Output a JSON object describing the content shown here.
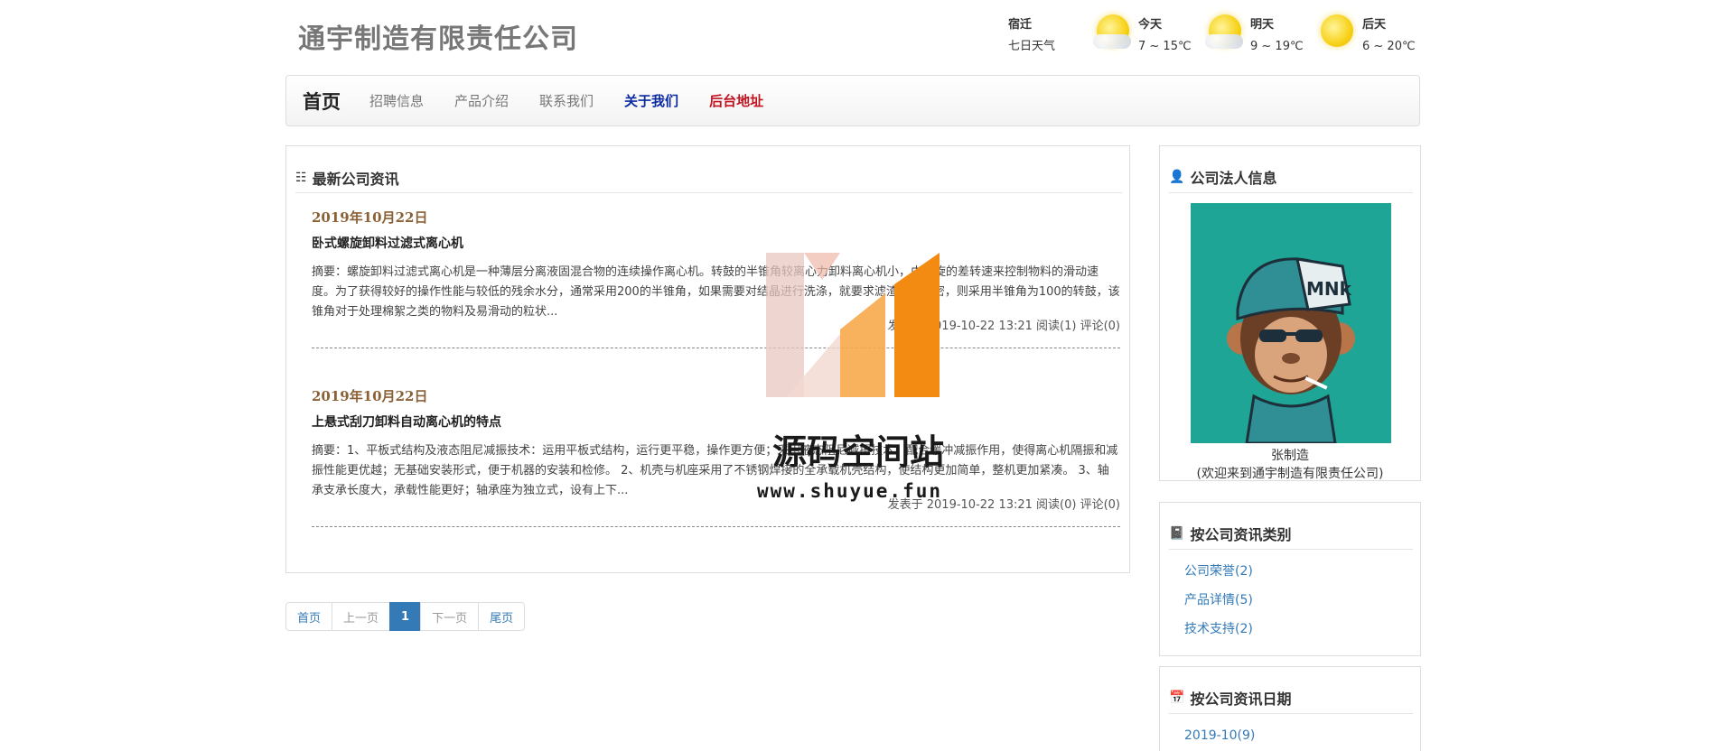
{
  "header": {
    "logo": "通宇制造有限责任公司"
  },
  "weather": {
    "city": "宿迁",
    "subtitle": "七日天气",
    "days": [
      {
        "label": "今天",
        "temp": "7 ~ 15℃",
        "icon": "sun-cloud-icon"
      },
      {
        "label": "明天",
        "temp": "9 ~ 19℃",
        "icon": "sun-cloud-icon"
      },
      {
        "label": "后天",
        "temp": "6 ~ 20℃",
        "icon": "sun-icon"
      }
    ]
  },
  "nav": {
    "brand": "首页",
    "items": [
      "招聘信息",
      "产品介绍",
      "联系我们",
      "关于我们",
      "后台地址"
    ]
  },
  "main": {
    "heading": "最新公司资讯",
    "articles": [
      {
        "date": "2019年10月22日",
        "title": "卧式螺旋卸料过滤式离心机",
        "summary": "摘要：螺旋卸料过滤式离心机是一种薄层分离液固混合物的连续操作离心机。转鼓的半锥角较离心力卸料离心机小，由螺旋的差转速来控制物料的滑动速度。为了获得较好的操作性能与较低的残余水分，通常采用200的半锥角，如果需要对结晶进行洗涤，就要求滤渣较为紧密，则采用半锥角为100的转鼓，该锥角对于处理棉絮之类的物料及易滑动的粒状...",
        "meta": "发表于 2019-10-22 13:21 阅读(1) 评论(0)"
      },
      {
        "date": "2019年10月22日",
        "title": "上悬式刮刀卸料自动离心机的特点",
        "summary": "摘要：1、平板式结构及液态阻尼减振技术：运用平板式结构，运行更平稳，操作更方便；采用液态阻尼减振技术，配合缓冲减振作用，使得离心机隔振和减振性能更优越；无基础安装形式，便于机器的安装和检修。 2、机壳与机座采用了不锈钢焊接的全承载机壳结构，使结构更加简单，整机更加紧凑。 3、轴承支承长度大，承载性能更好；轴承座为独立式，设有上下...",
        "meta": "发表于 2019-10-22 13:21 阅读(0) 评论(0)"
      }
    ]
  },
  "pagination": [
    "首页",
    "上一页",
    "1",
    "下一页",
    "尾页"
  ],
  "sidebar": {
    "owner": {
      "heading": "公司法人信息",
      "name": "张制造",
      "welcome": "(欢迎来到通宇制造有限责任公司)",
      "avatar_text": "MNk"
    },
    "categories": {
      "heading": "按公司资讯类别",
      "items": [
        "公司荣誉(2)",
        "产品详情(5)",
        "技术支持(2)"
      ]
    },
    "dates": {
      "heading": "按公司资讯日期",
      "items": [
        "2019-10(9)"
      ]
    }
  },
  "watermark": {
    "text": "源码空间站",
    "url": "www.shuyue.fun"
  },
  "colors": {
    "link": "#337ab7",
    "date": "#8a6136",
    "nav_blue": "#0b2aa1",
    "nav_red": "#c1121f",
    "avatar_bg": "#1ea596"
  }
}
